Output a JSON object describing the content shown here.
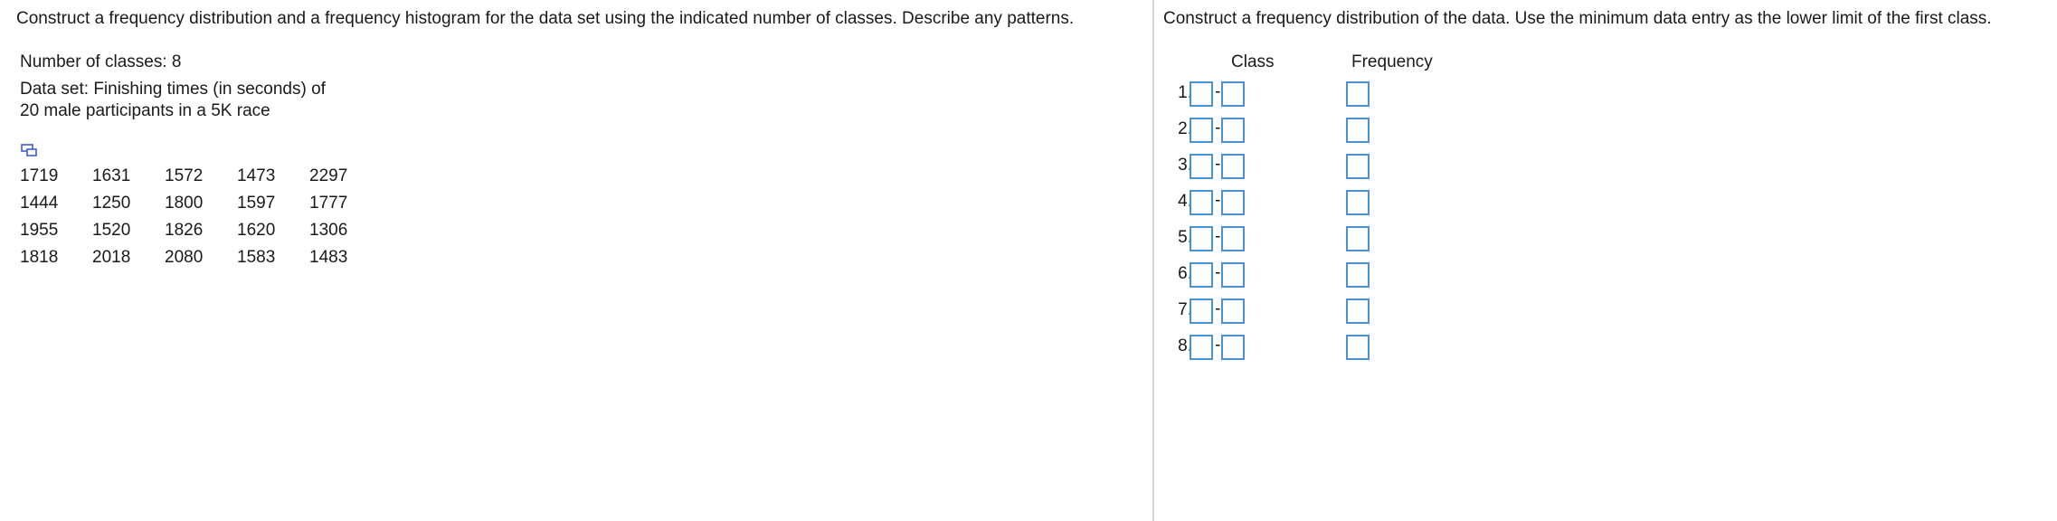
{
  "left": {
    "instruction": "Construct a frequency distribution and a frequency histogram for the data set using the indicated number of classes. Describe any patterns.",
    "num_classes": "Number of classes: 8",
    "dataset_line1": "Data set: Finishing times (in seconds) of",
    "dataset_line2": "20 male participants in a 5K race",
    "data_icon": "copy-data-icon",
    "data_rows": [
      [
        "1719",
        "1631",
        "1572",
        "1473",
        "2297"
      ],
      [
        "1444",
        "1250",
        "1800",
        "1597",
        "1777"
      ],
      [
        "1955",
        "1520",
        "1826",
        "1620",
        "1306"
      ],
      [
        "1818",
        "2018",
        "2080",
        "1583",
        "1483"
      ]
    ]
  },
  "right": {
    "instruction": "Construct a frequency distribution of the data. Use the minimum data entry as the lower limit of the first class.",
    "class_header": "Class",
    "frequency_header": "Frequency",
    "dash": "-",
    "rows": [
      {
        "num": "1.",
        "lower": "",
        "upper": "",
        "frequency": ""
      },
      {
        "num": "2.",
        "lower": "",
        "upper": "",
        "frequency": ""
      },
      {
        "num": "3.",
        "lower": "",
        "upper": "",
        "frequency": ""
      },
      {
        "num": "4.",
        "lower": "",
        "upper": "",
        "frequency": ""
      },
      {
        "num": "5.",
        "lower": "",
        "upper": "",
        "frequency": ""
      },
      {
        "num": "6.",
        "lower": "",
        "upper": "",
        "frequency": ""
      },
      {
        "num": "7.",
        "lower": "",
        "upper": "",
        "frequency": ""
      },
      {
        "num": "8.",
        "lower": "",
        "upper": "",
        "frequency": ""
      }
    ]
  },
  "colors": {
    "input_border": "#4a90d9",
    "divider": "#d4d6dc",
    "text": "#1a1a1a",
    "icon": "#3b5bdb"
  }
}
